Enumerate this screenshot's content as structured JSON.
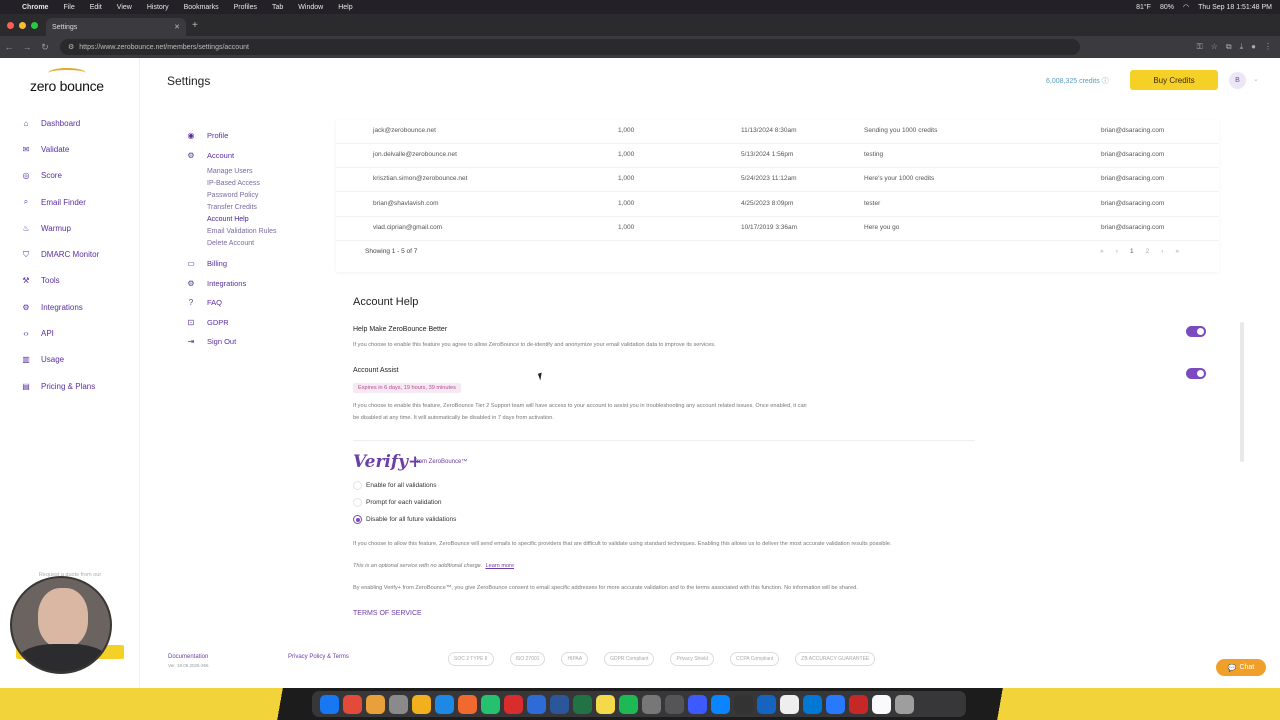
{
  "menubar": {
    "app": "Chrome",
    "items": [
      "File",
      "Edit",
      "View",
      "History",
      "Bookmarks",
      "Profiles",
      "Tab",
      "Window",
      "Help"
    ],
    "temp": "81°F",
    "battery": "80%",
    "datetime": "Thu Sep 18  1:51:48 PM"
  },
  "browser": {
    "tab_title": "Settings",
    "url": "https://www.zerobounce.net/members/settings/account"
  },
  "logo": {
    "text": "zero bounce"
  },
  "sidebar": {
    "items": [
      {
        "label": "Dashboard",
        "icon": "home-icon"
      },
      {
        "label": "Validate",
        "icon": "mail-icon"
      },
      {
        "label": "Score",
        "icon": "score-icon"
      },
      {
        "label": "Email Finder",
        "icon": "finder-icon"
      },
      {
        "label": "Warmup",
        "icon": "warmup-icon"
      },
      {
        "label": "DMARC Monitor",
        "icon": "shield-icon"
      },
      {
        "label": "Tools",
        "icon": "tools-icon"
      },
      {
        "label": "Integrations",
        "icon": "integrations-icon"
      },
      {
        "label": "API",
        "icon": "api-icon"
      },
      {
        "label": "Usage",
        "icon": "usage-icon"
      },
      {
        "label": "Pricing & Plans",
        "icon": "pricing-icon"
      }
    ],
    "quote_text": "Request a quote from our"
  },
  "header": {
    "title": "Settings",
    "credits": "6,008,325 credits",
    "buy_label": "Buy Credits",
    "avatar": "B"
  },
  "settings_nav": {
    "profile": "Profile",
    "account": "Account",
    "account_children": [
      "Manage Users",
      "IP-Based Access",
      "Password Policy",
      "Transfer Credits",
      "Account Help",
      "Email Validation Rules",
      "Delete Account"
    ],
    "active": "Account Help",
    "billing": "Billing",
    "integrations": "Integrations",
    "faq": "FAQ",
    "gdpr": "GDPR",
    "signout": "Sign Out"
  },
  "transfers": {
    "rows": [
      {
        "email": "jack@zerobounce.net",
        "amount": "1,000",
        "date": "11/13/2024 8:30am",
        "note": "Sending you 1000 credits",
        "from": "brian@dsaracing.com"
      },
      {
        "email": "jon.delvalle@zerobounce.net",
        "amount": "1,000",
        "date": "5/13/2024 1:56pm",
        "note": "testing",
        "from": "brian@dsaracing.com"
      },
      {
        "email": "krisztian.simon@zerobounce.net",
        "amount": "1,000",
        "date": "5/24/2023 11:12am",
        "note": "Here's your 1000 credits",
        "from": "brian@dsaracing.com"
      },
      {
        "email": "brian@shavlavish.com",
        "amount": "1,000",
        "date": "4/25/2023 8:09pm",
        "note": "tester",
        "from": "brian@dsaracing.com"
      },
      {
        "email": "vlad.ciprian@gmail.com",
        "amount": "1,000",
        "date": "10/17/2019 3:36am",
        "note": "Here you go",
        "from": "brian@dsaracing.com"
      }
    ],
    "showing": "Showing 1 - 5 of 7",
    "pager": [
      "«",
      "‹",
      "1",
      "2",
      "›",
      "»"
    ]
  },
  "account_help": {
    "title": "Account Help",
    "help_better_label": "Help Make ZeroBounce Better",
    "help_better_desc": "If you choose to enable this feature you agree to allow ZeroBounce to de-identify and anonymize your email validation data to improve its services.",
    "help_better_on": true,
    "assist_label": "Account Assist",
    "assist_expiry": "Expires in 6 days, 19 hours, 39 minutes",
    "assist_desc1": "If you choose to enable this feature, ZeroBounce Tier 2 Support team will have access to your account to assist you in troubleshooting any account related issues. Once enabled, it can",
    "assist_desc2": "be disabled at any time. It will automatically be disabled in 7 days from activation.",
    "assist_on": true
  },
  "verify": {
    "brand": "Verify+",
    "brand_sub": "from ZeroBounce™",
    "options": [
      "Enable for all validations",
      "Prompt for each validation",
      "Disable for all future validations"
    ],
    "selected": 2,
    "desc": "If you choose to allow this feature, ZeroBounce will send emails to specific providers that are difficult to validate using standard techniques. Enabling this allows us to deliver the most accurate validation results possible.",
    "optional": "This is an optional service with no additional charge.",
    "learn_more": "Learn more",
    "consent": "By enabling Verify+ from ZeroBounce™, you give ZeroBounce consent to email specific addresses for more accurate validation and to the terms associated with this function. No information will be shared.",
    "tos": "TERMS OF SERVICE"
  },
  "footer": {
    "documentation": "Documentation",
    "version": "Ver. 18.09.2025-366",
    "privacy": "Privacy Policy & Terms",
    "badges": [
      "SOC 2 TYPE II",
      "ISO 27001",
      "HIPAA",
      "GDPR Compliant",
      "Privacy Shield",
      "CCPA Compliant",
      "ZB ACCURACY GUARANTEE"
    ],
    "chat": "Chat"
  },
  "colors": {
    "brand": "#5a2fa1",
    "accent": "#f5d027",
    "toggle": "#7b4ac0"
  }
}
